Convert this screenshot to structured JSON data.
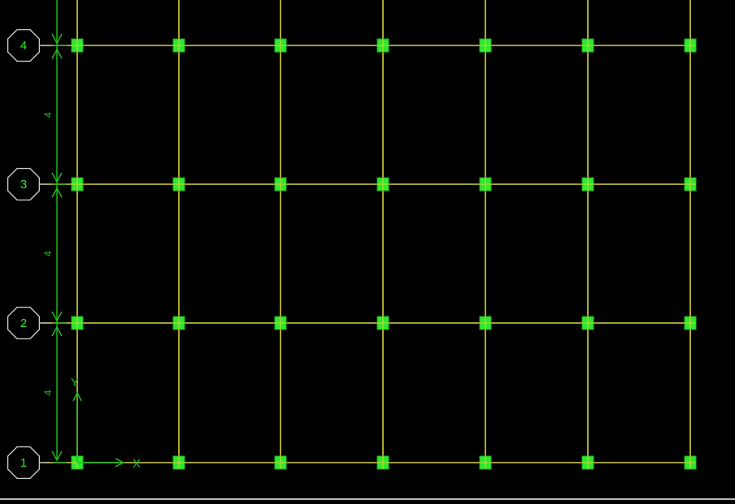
{
  "colors": {
    "background": "#000000",
    "gridline": "#d8d23a",
    "column": "#2ee82e",
    "column_border": "#22b022",
    "dimension": "#21c221",
    "bubble": "#c8c8c8",
    "bubble_text": "#2ee82e",
    "axis": "#21c221",
    "status_line": "#b9b9b9"
  },
  "grid": {
    "bubbles": [
      "4",
      "3",
      "2",
      "1"
    ],
    "spacings": [
      "4",
      "4",
      "4"
    ],
    "column_count_per_row": 7
  },
  "axes": {
    "x_label": "X",
    "y_label": "Y"
  }
}
